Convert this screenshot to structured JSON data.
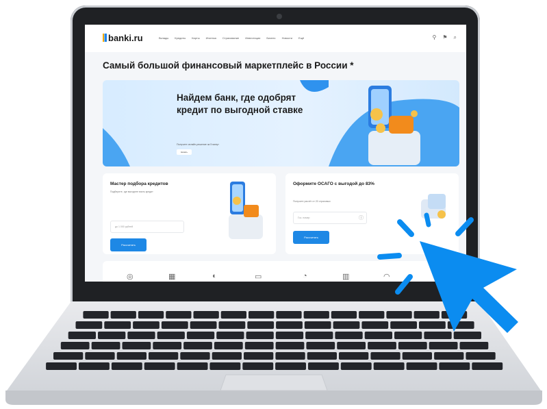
{
  "site": {
    "logo": "banki.ru",
    "menu": [
      "Вклады",
      "Кредиты",
      "Карты",
      "Ипотека",
      "Страхование",
      "Инвестиции",
      "Бизнес",
      "Новости",
      "Ещё"
    ],
    "heading": "Самый большой финансовый маркетплейс в России *"
  },
  "hero": {
    "title": "Найдем банк, где одобрят кредит по выгодной ставке",
    "subtitle": "Получите онлайн-решение за 5 минут",
    "button": "Начать"
  },
  "card_credit": {
    "title": "Мастер подбора кредитов",
    "subtitle": "Подберите, где выгоднее взять кредит",
    "input_placeholder": "до 1 000 рублей",
    "button": "Рассчитать"
  },
  "card_osago": {
    "title": "Оформите ОСАГО с выгодой до 83%",
    "subtitle": "Получите расчёт от 20 страховых",
    "input_placeholder": "Гос. номер",
    "button": "Рассчитать"
  },
  "colors": {
    "accent": "#1e88e5",
    "cursor": "#0b8cf0",
    "bezel": "#1f2124"
  },
  "icons": [
    "coin-icon",
    "building-icon",
    "wallet-icon",
    "card-icon",
    "clock-icon",
    "chart-icon",
    "gauge-icon"
  ]
}
